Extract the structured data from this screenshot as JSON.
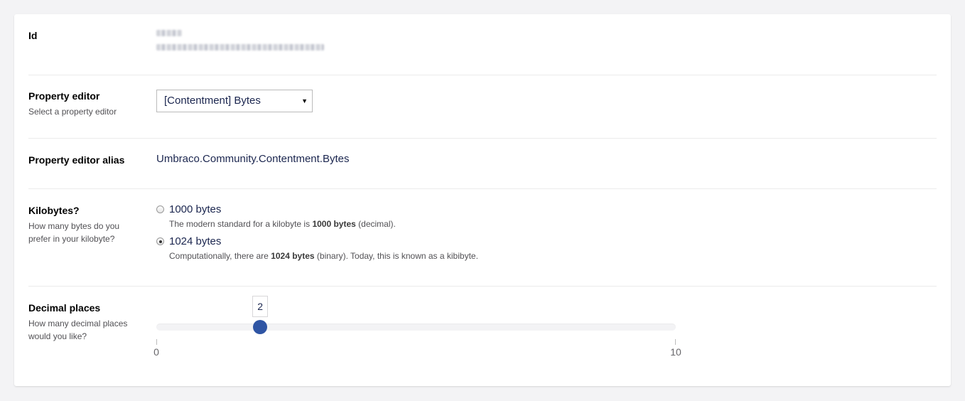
{
  "fields": {
    "id": {
      "label": "Id"
    },
    "property_editor": {
      "label": "Property editor",
      "description": "Select a property editor",
      "selected": "[Contentment] Bytes"
    },
    "alias": {
      "label": "Property editor alias",
      "value": "Umbraco.Community.Contentment.Bytes"
    },
    "kilobytes": {
      "label": "Kilobytes?",
      "description": "How many bytes do you prefer in your kilobyte?",
      "options": [
        {
          "label": "1000 bytes",
          "help_pre": "The modern standard for a kilobyte is ",
          "help_bold": "1000 bytes",
          "help_post": " (decimal).",
          "checked": false
        },
        {
          "label": "1024 bytes",
          "help_pre": "Computationally, there are ",
          "help_bold": "1024 bytes",
          "help_post": " (binary). Today, this is known as a kibibyte.",
          "checked": true
        }
      ]
    },
    "decimal_places": {
      "label": "Decimal places",
      "description": "How many decimal places would you like?",
      "value": 2,
      "value_text": "2",
      "min": 0,
      "max": 10,
      "min_text": "0",
      "max_text": "10"
    }
  },
  "colors": {
    "slider_handle": "#2f55a4",
    "text_primary": "#1b264f",
    "page_background": "#f3f3f5"
  },
  "icons": {
    "select_caret": "caret-down-icon"
  }
}
